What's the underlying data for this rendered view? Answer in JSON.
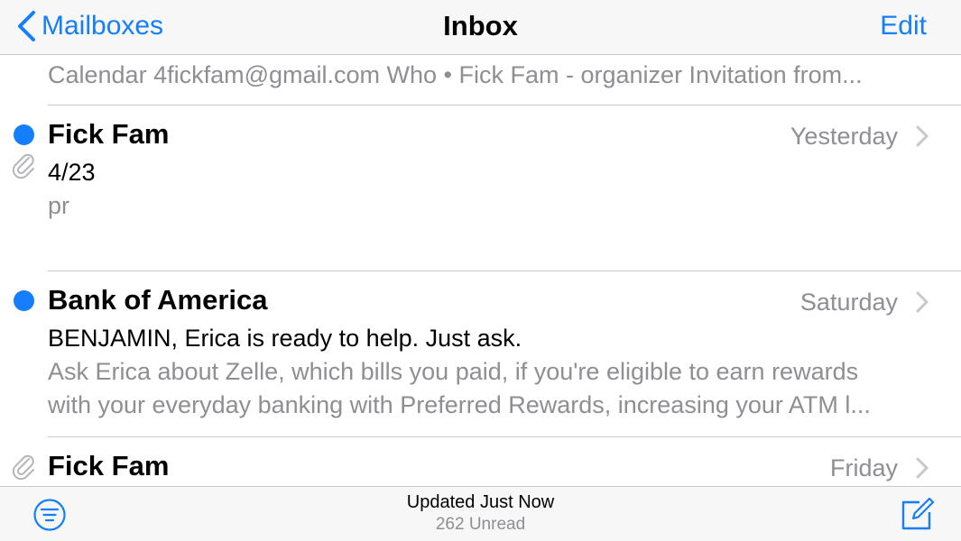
{
  "nav": {
    "back_label": "Mailboxes",
    "title": "Inbox",
    "edit_label": "Edit"
  },
  "partial_message": {
    "preview": "Calendar 4fickfam@gmail.com Who • Fick Fam - organizer Invitation from..."
  },
  "messages": [
    {
      "sender": "Fick Fam",
      "date": "Yesterday",
      "subject": "4/23",
      "preview_lines": [
        "pr"
      ],
      "unread": true,
      "attachment": true
    },
    {
      "sender": "Bank of America",
      "date": "Saturday",
      "subject": "BENJAMIN, Erica is ready to help. Just ask.",
      "preview_lines": [
        "Ask Erica about Zelle, which bills you paid, if you're eligible to earn rewards",
        "with your everyday banking with Preferred Rewards, increasing your ATM l..."
      ],
      "unread": true,
      "attachment": false
    },
    {
      "sender": "Fick Fam",
      "date": "Friday",
      "unread": false,
      "attachment": true
    }
  ],
  "toolbar": {
    "status": "Updated Just Now",
    "unread_count": "262 Unread"
  },
  "icons": {
    "back": "chevron-left-icon",
    "filter": "filter-icon",
    "compose": "compose-icon",
    "attachment": "paperclip-icon",
    "disclosure": "chevron-right-icon"
  },
  "colors": {
    "accent": "#147efb",
    "secondary_text": "#8e8e93",
    "separator": "#c8c7cc",
    "bar_background": "#f7f7f7"
  }
}
